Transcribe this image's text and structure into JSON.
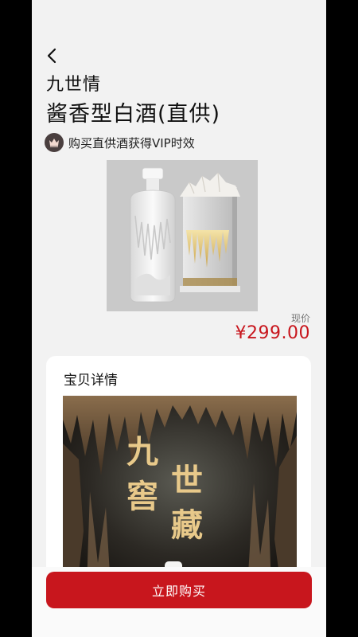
{
  "header": {
    "back_icon": "chevron-left-icon",
    "title_line1": "九世情",
    "title_line2": "酱香型白酒(直供)"
  },
  "vip": {
    "icon": "crown-icon",
    "text": "购买直供酒获得VIP时效"
  },
  "product": {
    "image": "white-porcelain-baijiu-bottle-with-gift-box",
    "price_label": "现价",
    "price": "¥299.00"
  },
  "detail": {
    "title": "宝贝详情",
    "poster": {
      "line1_left": "九",
      "line1_right": "世",
      "line2_left": "窖",
      "line2_right": "藏"
    }
  },
  "footer": {
    "buy_label": "立即购买"
  },
  "colors": {
    "accent": "#c8161d",
    "page_bg": "#f2f2f2",
    "poster_text": "#e8c98a"
  }
}
